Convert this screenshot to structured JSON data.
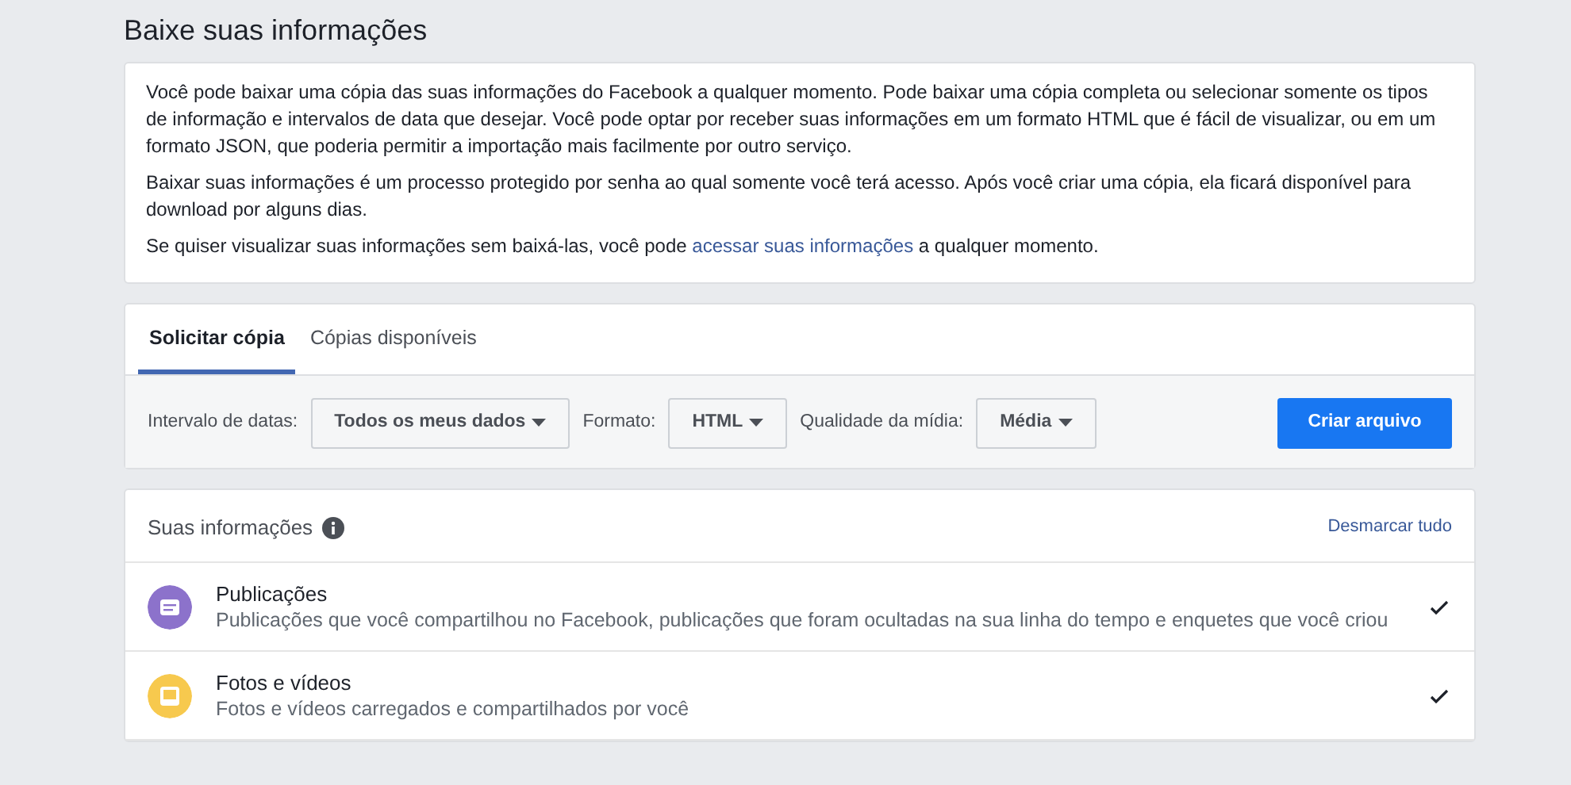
{
  "page_title": "Baixe suas informações",
  "intro": {
    "paragraphs": [
      "Você pode baixar uma cópia das suas informações do Facebook a qualquer momento. Pode baixar uma cópia completa ou selecionar somente os tipos de informação e intervalos de data que desejar. Você pode optar por receber suas informações em um formato HTML que é fácil de visualizar, ou em um formato JSON, que poderia permitir a importação mais facilmente por outro serviço.",
      "Baixar suas informações é um processo protegido por senha ao qual somente você terá acesso. Após você criar uma cópia, ela ficará disponível para download por alguns dias."
    ],
    "link_sentence": {
      "before": "Se quiser visualizar suas informações sem baixá-las, você pode ",
      "link": "acessar suas informações",
      "after": " a qualquer momento."
    }
  },
  "tabs": [
    {
      "label": "Solicitar cópia",
      "selected": true
    },
    {
      "label": "Cópias disponíveis",
      "selected": false
    }
  ],
  "filters": [
    {
      "label": "Intervalo de datas:",
      "value": "Todos os meus dados"
    },
    {
      "label": "Formato:",
      "value": "HTML"
    },
    {
      "label": "Qualidade da mídia:",
      "value": "Média"
    }
  ],
  "create_button": "Criar arquivo",
  "info_section": {
    "title": "Suas informações",
    "deselect_all": "Desmarcar tudo",
    "categories": [
      {
        "kind": "posts",
        "color": "#8c72cb",
        "title": "Publicações",
        "description": "Publicações que você compartilhou no Facebook, publicações que foram ocultadas na sua linha do tempo e enquetes que você criou",
        "checked": true
      },
      {
        "kind": "photos",
        "color": "#f7c94e",
        "title": "Fotos e vídeos",
        "description": "Fotos e vídeos carregados e compartilhados por você",
        "checked": true
      }
    ]
  }
}
